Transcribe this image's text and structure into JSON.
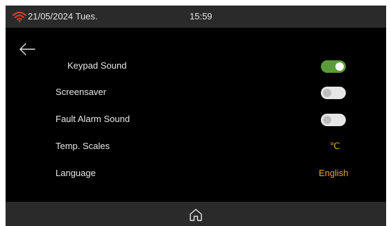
{
  "status_bar": {
    "date": "21/05/2024 Tues.",
    "time": "15:59",
    "wifi_icon": "wifi-icon",
    "wifi_color": "#e8402f"
  },
  "nav": {
    "back_icon": "arrow-left-icon",
    "home_icon": "home-icon"
  },
  "settings": {
    "keypad_sound": {
      "label": "Keypad Sound",
      "enabled": true
    },
    "screensaver": {
      "label": "Screensaver",
      "enabled": false
    },
    "fault_alarm_sound": {
      "label": "Fault Alarm Sound",
      "enabled": false
    },
    "temp_scales": {
      "label": "Temp. Scales",
      "value": "℃"
    },
    "language": {
      "label": "Language",
      "value": "English"
    }
  },
  "colors": {
    "background": "#000000",
    "bar": "#2a2a2a",
    "toggle_on": "#5a9c3a",
    "toggle_off": "#e6e6e6",
    "value_accent": "#e0a53a"
  }
}
